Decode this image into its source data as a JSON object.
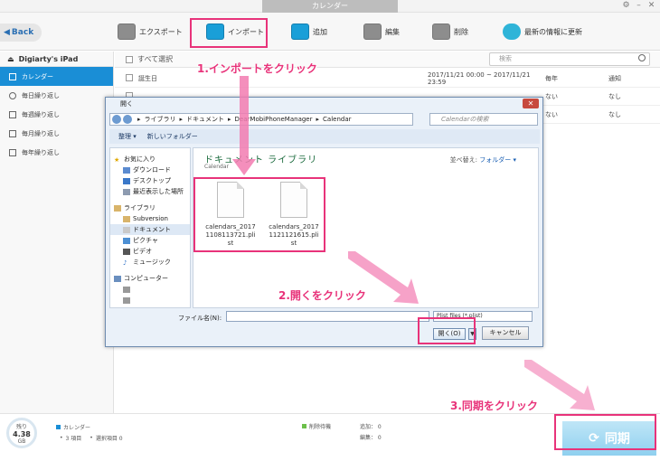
{
  "window": {
    "title": "カレンダー"
  },
  "toolbar": {
    "back_label": "Back",
    "items": [
      {
        "label": "エクスポート",
        "icon": "export-icon"
      },
      {
        "label": "インポート",
        "icon": "import-icon"
      },
      {
        "label": "追加",
        "icon": "add-icon"
      },
      {
        "label": "編集",
        "icon": "edit-icon"
      },
      {
        "label": "削除",
        "icon": "trash-icon"
      },
      {
        "label": "最新の情報に更新",
        "icon": "refresh-icon"
      }
    ]
  },
  "sidebar": {
    "device": "Digiarty's iPad",
    "items": [
      {
        "label": "カレンダー",
        "active": true
      },
      {
        "label": "毎日繰り返し"
      },
      {
        "label": "毎週繰り返し"
      },
      {
        "label": "毎月繰り返し"
      },
      {
        "label": "毎年繰り返し"
      }
    ]
  },
  "list": {
    "select_all": "すべて選択",
    "search_placeholder": "検索",
    "rows": [
      {
        "title": "誕生日",
        "time": "2017/11/21 00:00 ~ 2017/11/21 23:59",
        "repeat": "毎年",
        "alert": "通知"
      },
      {
        "title": "",
        "time": "",
        "repeat": "ない",
        "alert": "なし"
      },
      {
        "title": "",
        "time": "",
        "repeat": "ない",
        "alert": "なし"
      }
    ]
  },
  "dialog": {
    "title": "開く",
    "address": [
      "ライブラリ",
      "ドキュメント",
      "DearMobiPhoneManager",
      "Calendar"
    ],
    "search_placeholder": "Calendarの検索",
    "organize": "整理 ▾",
    "new_folder": "新しいフォルダー",
    "tree": [
      {
        "label": "お気に入り",
        "group": true
      },
      {
        "label": "ダウンロード"
      },
      {
        "label": "デスクトップ"
      },
      {
        "label": "最近表示した場所"
      },
      {
        "label": "ライブラリ",
        "group": true
      },
      {
        "label": "Subversion"
      },
      {
        "label": "ドキュメント",
        "selected": true
      },
      {
        "label": "ピクチャ"
      },
      {
        "label": "ビデオ"
      },
      {
        "label": "ミュージック"
      },
      {
        "label": "コンピューター",
        "group": true
      },
      {
        "label": ""
      },
      {
        "label": ""
      }
    ],
    "lib_title": "ドキュメント ライブラリ",
    "lib_sub": "Calendar",
    "arrange_label": "並べ替え:",
    "arrange_value": "フォルダー ▾",
    "files": [
      {
        "name": "calendars_20171108113721.plist"
      },
      {
        "name": "calendars_20171121121615.plist"
      }
    ],
    "filename_label": "ファイル名(N):",
    "filetype": "Plist files (*.plist)",
    "open_label": "開く(O)",
    "cancel_label": "キャンセル"
  },
  "annotations": {
    "step1": "1.インポートをクリック",
    "step2": "2.開くをクリック",
    "step3": "3.同期をクリック",
    "accent": "#e8337a"
  },
  "footer": {
    "storage_top": "残り",
    "storage_value": "4.38",
    "storage_unit": "GB",
    "cal_label": "カレンダー",
    "count_label": "3 項目",
    "selected_label": "選択項目 0",
    "pending_delete": "削除待機",
    "added": "追加： 0",
    "edited": "編集： 0",
    "sync_label": "同期"
  }
}
